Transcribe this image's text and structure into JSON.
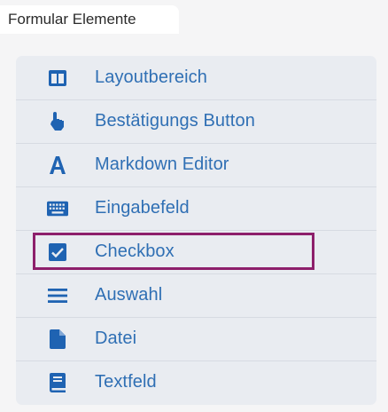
{
  "header": {
    "tab_title": "Formular Elemente"
  },
  "colors": {
    "accent": "#2f6fb4",
    "icon": "#1f63b2",
    "highlight": "#8d1f6b",
    "panel_bg": "#e9ecf1"
  },
  "items": [
    {
      "label": "Layoutbereich",
      "icon": "layout-columns-icon"
    },
    {
      "label": "Bestätigungs Button",
      "icon": "hand-pointer-icon"
    },
    {
      "label": "Markdown Editor",
      "icon": "font-a-icon"
    },
    {
      "label": "Eingabefeld",
      "icon": "keyboard-icon"
    },
    {
      "label": "Checkbox",
      "icon": "checkbox-checked-icon",
      "highlighted": true
    },
    {
      "label": "Auswahl",
      "icon": "list-lines-icon"
    },
    {
      "label": "Datei",
      "icon": "file-icon"
    },
    {
      "label": "Textfeld",
      "icon": "book-icon"
    }
  ]
}
